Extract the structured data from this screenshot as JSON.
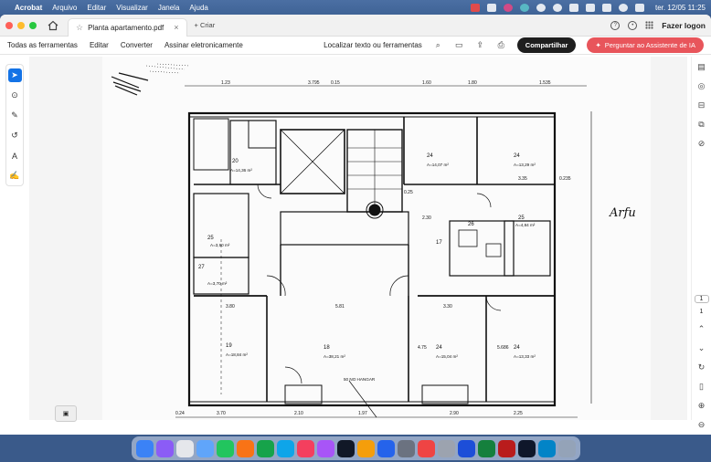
{
  "menubar": {
    "app_name": "Acrobat",
    "menus": [
      "Arquivo",
      "Editar",
      "Visualizar",
      "Janela",
      "Ajuda"
    ],
    "clock": "ter. 12/05  11:25"
  },
  "tabbar": {
    "document_tab": "Planta apartamento.pdf",
    "new_tab_label": "+ Criar",
    "login_label": "Fazer logon"
  },
  "toolbar": {
    "links": [
      "Todas as ferramentas",
      "Editar",
      "Converter",
      "Assinar eletronicamente"
    ],
    "search_label": "Localizar texto ou ferramentas",
    "share_label": "Compartilhar",
    "ai_label": "Perguntar ao Assistente de IA"
  },
  "page_nav": {
    "current": "1",
    "total": "1"
  },
  "plan": {
    "rooms": [
      {
        "num": "20",
        "area": "A=14,36 m²"
      },
      {
        "num": "24",
        "area": "A=14,07 m²"
      },
      {
        "num": "24",
        "area": "A=13,29 m²"
      },
      {
        "num": "25",
        "area": "A=3,90 m²"
      },
      {
        "num": "25",
        "area": "A=4,84 m²"
      },
      {
        "num": "27",
        "area": "A=3,70 m²"
      },
      {
        "num": "19",
        "area": "A=18,84 m²"
      },
      {
        "num": "18",
        "area": "A=38,21 m²"
      },
      {
        "num": "24",
        "area": "A=15,04 m²"
      },
      {
        "num": "24",
        "area": "A=13,33 m²"
      },
      {
        "num": "17",
        "area": ""
      },
      {
        "num": "26",
        "area": ""
      }
    ],
    "dims": [
      "1.23",
      "3.795",
      "0.15",
      "1.60",
      "1.80",
      "1.535",
      "3.80",
      "5.81",
      "3.30",
      "2.30",
      "3.35",
      "3.70",
      "2.10",
      "1.97",
      "2.90",
      "2.25",
      "0.24",
      "0.235",
      "0.25",
      "4.75",
      "5.686"
    ],
    "note": "50 NO\nHANGAR",
    "signature": "Arfu"
  },
  "colors": {
    "accent": "#1473e6",
    "ai": "#e8555b"
  }
}
